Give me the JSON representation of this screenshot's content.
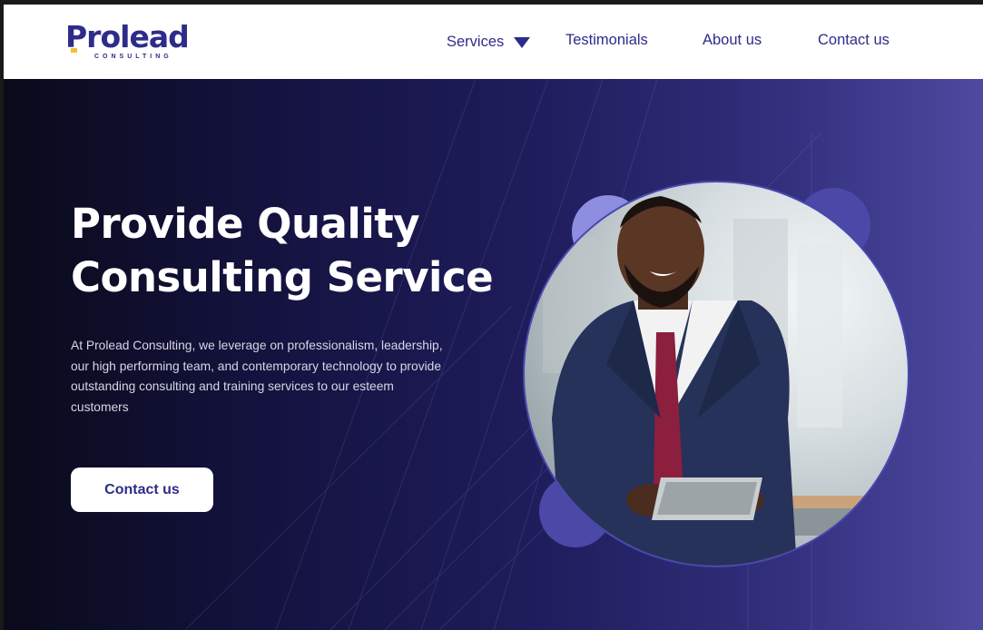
{
  "brand": {
    "name": "Prolead",
    "tagline": "CONSULTING",
    "color": "#2e2c8a"
  },
  "nav": {
    "items": [
      {
        "label": "Services",
        "has_dropdown": true,
        "icon": "chevron-down-icon"
      },
      {
        "label": "Testimonials"
      },
      {
        "label": "About us"
      },
      {
        "label": "Contact us"
      }
    ]
  },
  "hero": {
    "title_line1": "Provide Quality",
    "title_line2": "Consulting Service",
    "description": "At Prolead Consulting, we leverage on professionalism, leadership, our high performing team, and contemporary technology to provide outstanding consulting and training services to our esteem customers",
    "cta_label": "Contact us",
    "image": "businessman-with-tablet-photo"
  },
  "colors": {
    "accent": "#2e2c8a",
    "hero_start": "#0a0a1a",
    "hero_end": "#4d4aa0",
    "blob_light": "#8e8ee0",
    "blob_dark": "#4b48a8"
  }
}
